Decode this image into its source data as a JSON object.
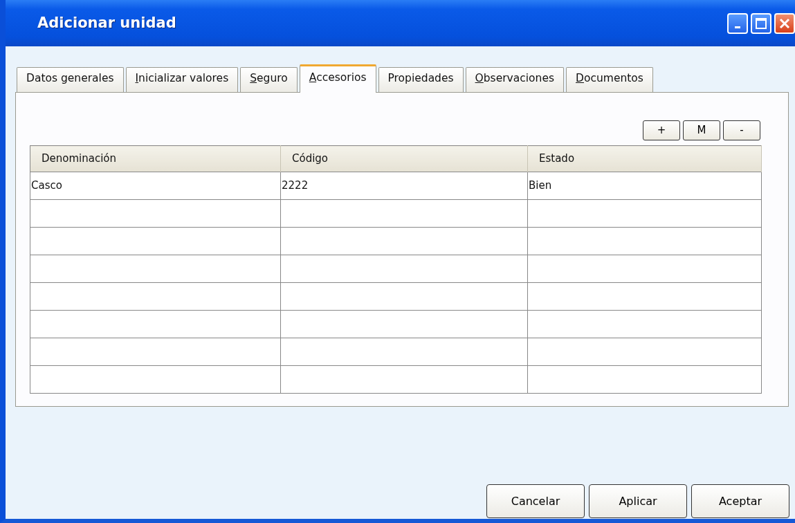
{
  "window": {
    "title": "Adicionar unidad"
  },
  "tabs": [
    {
      "label": "Datos generales",
      "selected": false,
      "mnemonic": false
    },
    {
      "label": "Inicializar valores",
      "selected": false,
      "mnemonic": true
    },
    {
      "label": "Seguro",
      "selected": false,
      "mnemonic": true
    },
    {
      "label": "Accesorios",
      "selected": true,
      "mnemonic": true
    },
    {
      "label": "Propiedades",
      "selected": false,
      "mnemonic": false
    },
    {
      "label": "Observaciones",
      "selected": false,
      "mnemonic": true
    },
    {
      "label": "Documentos",
      "selected": false,
      "mnemonic": true
    }
  ],
  "toolbar": [
    "+",
    "M",
    "-"
  ],
  "table": {
    "columns": [
      "Denominación",
      "Código",
      "Estado"
    ],
    "rows": [
      [
        "Casco",
        "2222",
        "Bien"
      ]
    ]
  },
  "buttons": [
    "Cancelar",
    "Aplicar",
    "Aceptar"
  ]
}
